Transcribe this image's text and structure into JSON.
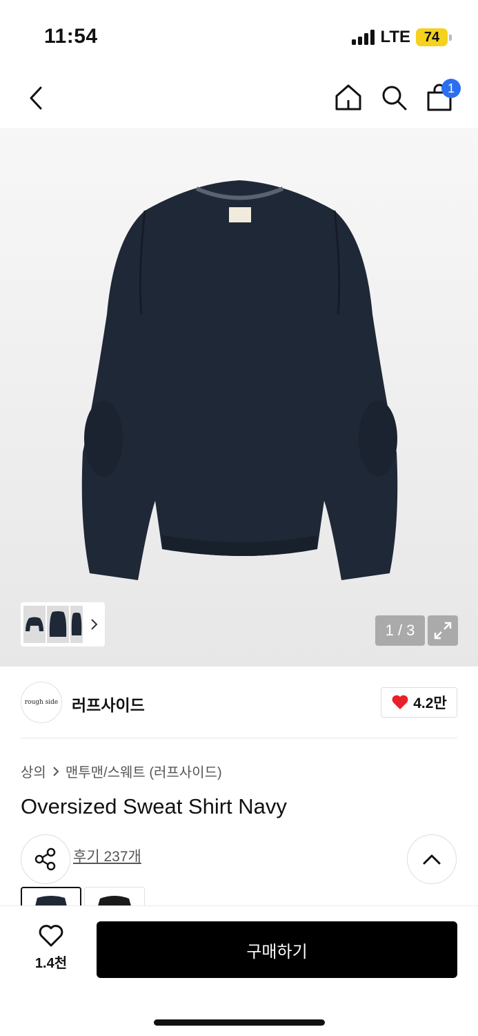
{
  "status": {
    "time": "11:54",
    "network": "LTE",
    "battery": "74"
  },
  "nav": {
    "cart_count": "1"
  },
  "gallery": {
    "counter": "1 / 3"
  },
  "brand": {
    "logo_text": "rough side",
    "name": "러프사이드",
    "likes": "4.2만"
  },
  "product": {
    "breadcrumb": [
      "상의",
      "맨투맨/스웨트 (러프사이드)"
    ],
    "title": "Oversized Sweat Shirt Navy",
    "review_link": "후기 237개"
  },
  "bottom_bar": {
    "wish_count": "1.4천",
    "buy_label": "구매하기"
  },
  "colors": {
    "accent_badge": "#2b6ef2",
    "battery": "#f4d21e",
    "like_heart": "#e8202a",
    "product_navy": "#1f2836"
  }
}
